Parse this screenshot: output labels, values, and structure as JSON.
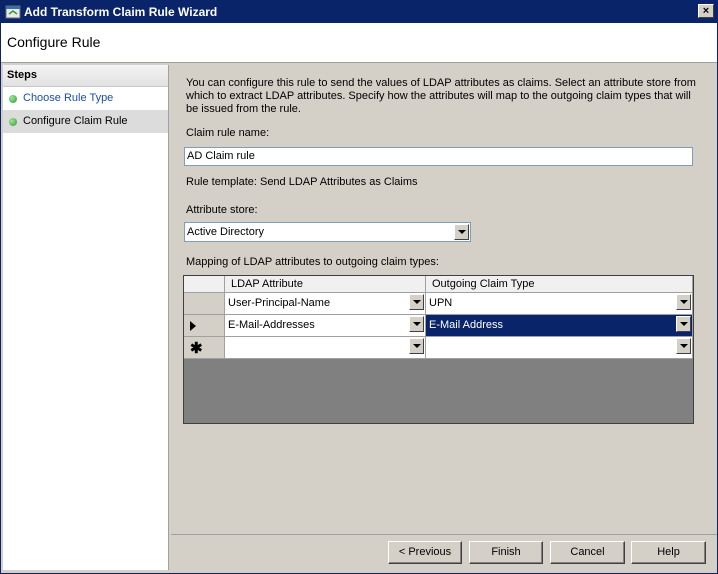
{
  "window": {
    "title": "Add Transform Claim Rule Wizard",
    "close_label": "×"
  },
  "header": {
    "title": "Configure Rule"
  },
  "steps": {
    "title": "Steps",
    "items": [
      {
        "label": "Choose Rule Type"
      },
      {
        "label": "Configure Claim Rule"
      }
    ]
  },
  "content": {
    "description": "You can configure this rule to send the values of LDAP attributes as claims. Select an attribute store from which to extract LDAP attributes. Specify how the attributes will map to the outgoing claim types that will be issued from the rule.",
    "claim_rule_name_label": "Claim rule name:",
    "claim_rule_name_value": "AD Claim rule",
    "rule_template": "Rule template: Send LDAP Attributes as Claims",
    "attribute_store_label": "Attribute store:",
    "attribute_store_value": "Active Directory",
    "mapping_label": "Mapping of LDAP attributes to outgoing claim types:",
    "grid": {
      "columns": [
        "LDAP Attribute",
        "Outgoing Claim Type"
      ],
      "rows": [
        {
          "ldap": "User-Principal-Name",
          "claim": "UPN"
        },
        {
          "ldap": "E-Mail-Addresses",
          "claim": "E-Mail Address"
        },
        {
          "ldap": "",
          "claim": ""
        }
      ]
    }
  },
  "buttons": {
    "previous": "< Previous",
    "finish": "Finish",
    "cancel": "Cancel",
    "help": "Help"
  },
  "colors": {
    "titlebar": "#0a246a",
    "selection": "#0a246a",
    "step_indicator": "#2f9b2f"
  }
}
